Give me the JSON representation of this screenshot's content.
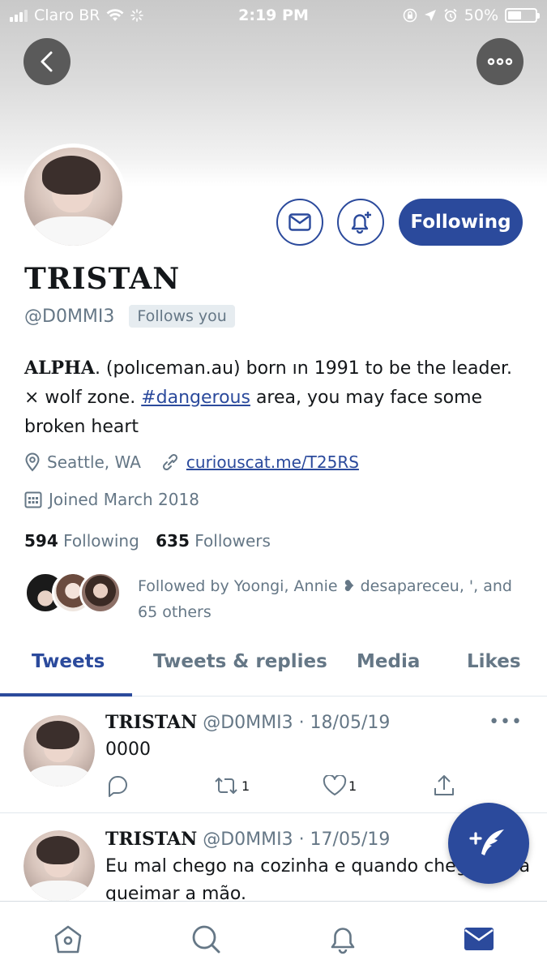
{
  "status_bar": {
    "carrier": "Claro BR",
    "time": "2:19 PM",
    "battery": "50%",
    "battery_level": 0.5
  },
  "header": {
    "back_icon": "chevron-left-icon",
    "more_icon": "ellipsis-icon"
  },
  "profile": {
    "name": "TRISTAN",
    "handle": "@D0MMI3",
    "follows_you": "Follows you",
    "follow_button": "Following",
    "bio": {
      "alpha": "ALPHA",
      "part1": ". (polıceman.au) born ın 1991 to be the leader. × wolf zone. ",
      "hashtag": "#dangerous",
      "part2": " area, you may face some broken heart"
    },
    "location": "Seattle, WA",
    "website": "curiouscat.me/T25RS",
    "joined": "Joined March 2018",
    "following_count": "594",
    "following_label": "Following",
    "followers_count": "635",
    "followers_label": "Followers",
    "followed_by": "Followed by Yoongi, Annie ❥ desapareceu, ', and 65 others"
  },
  "tabs": [
    "Tweets",
    "Tweets & replies",
    "Media",
    "Likes"
  ],
  "tweets": [
    {
      "name": "TRISTAN",
      "meta": "@D0MMI3 · 18/05/19",
      "text": "0000",
      "retweets": "1",
      "likes": "1"
    },
    {
      "name": "TRISTAN",
      "meta": "@D0MMI3 · 17/05/19",
      "text": "Eu mal chego na cozinha e quando chego é pra queimar a mão."
    }
  ],
  "colors": {
    "accent": "#2b4a9c",
    "secondary_text": "#657786",
    "divider": "#e1e8ed"
  }
}
